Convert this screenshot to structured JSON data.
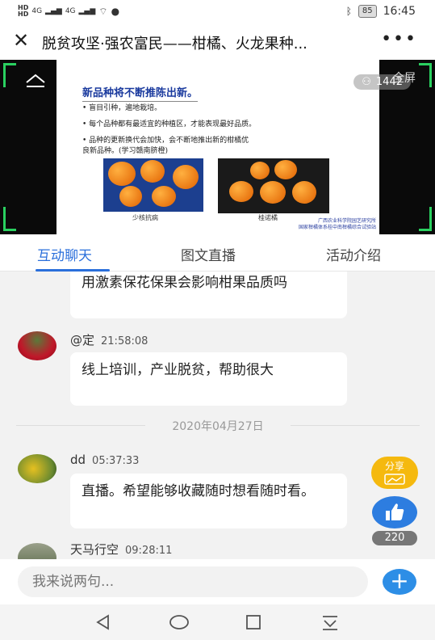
{
  "status": {
    "network_a": "4G",
    "network_b": "4G",
    "battery": "85",
    "time": "16:45"
  },
  "header": {
    "title": "脱贫攻坚·强农富民——柑橘、火龙果种...",
    "close_icon": "close-icon",
    "more_icon": "more-icon"
  },
  "video": {
    "viewers": "1442",
    "fullscreen_label": "全屏",
    "slide": {
      "title": "新品种将不断推陈出新。",
      "bullets": [
        "• 盲目引种，遍地栽培。",
        "• 每个品种都有最适宜的种植区，才能表现最好品质。",
        "• 品种的更新换代会加快，会不断地推出新的柑橘优",
        "  良新品种。(学习赣南脐橙)"
      ],
      "caption_left": "少核抗病",
      "caption_right": "桂诺橘",
      "footer_line1": "广西农业科学院园艺研究所",
      "footer_line2": "国家柑橘体系桂中南柑橘综合试验站"
    }
  },
  "tabs": [
    {
      "label": "互动聊天",
      "active": true
    },
    {
      "label": "图文直播",
      "active": false
    },
    {
      "label": "活动介绍",
      "active": false
    }
  ],
  "messages": [
    {
      "user": "",
      "time": "",
      "text": "用激素保花保果会影响柑果品质吗"
    },
    {
      "user": "@定",
      "time": "21:58:08",
      "text": "线上培训，产业脱贫，帮助很大"
    },
    {
      "user": "dd",
      "time": "05:37:33",
      "text": "直播。希望能够收藏随时想看随时看。"
    },
    {
      "user": "天马行空",
      "time": "09:28:11",
      "text": ""
    }
  ],
  "date_separator": "2020年04月27日",
  "share_label": "分享",
  "like_count": "220",
  "input": {
    "placeholder": "我来说两句..."
  },
  "colors": {
    "accent": "#2a6fdb",
    "share": "#f5b90f",
    "like": "#2d7de0"
  }
}
